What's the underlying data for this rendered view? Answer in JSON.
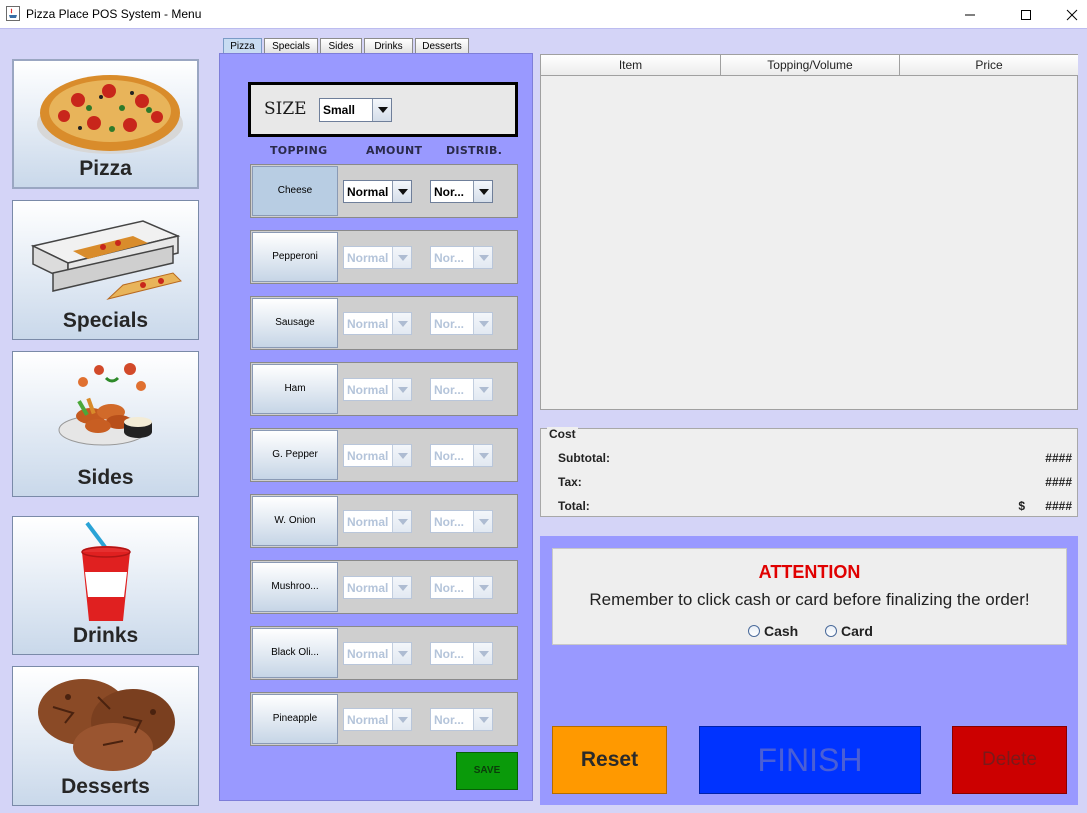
{
  "window": {
    "title": "Pizza Place POS System - Menu"
  },
  "nav": {
    "items": [
      {
        "label": "Pizza",
        "icon": "pizza-icon"
      },
      {
        "label": "Specials",
        "icon": "pizza-box-icon"
      },
      {
        "label": "Sides",
        "icon": "wings-icon"
      },
      {
        "label": "Drinks",
        "icon": "soda-cup-icon"
      },
      {
        "label": "Desserts",
        "icon": "cookies-icon"
      }
    ]
  },
  "tabs": [
    {
      "label": "Pizza",
      "selected": true
    },
    {
      "label": "Specials",
      "selected": false
    },
    {
      "label": "Sides",
      "selected": false
    },
    {
      "label": "Drinks",
      "selected": false
    },
    {
      "label": "Desserts",
      "selected": false
    }
  ],
  "pizza": {
    "size_label": "SIZE",
    "size_value": "Small",
    "headers": {
      "topping": "TOPPING",
      "amount": "AMOUNT",
      "distrib": "DISTRIB."
    },
    "toppings": [
      {
        "name": "Cheese",
        "amount": "Normal",
        "distrib": "Nor...",
        "enabled": true
      },
      {
        "name": "Pepperoni",
        "amount": "Normal",
        "distrib": "Nor...",
        "enabled": false
      },
      {
        "name": "Sausage",
        "amount": "Normal",
        "distrib": "Nor...",
        "enabled": false
      },
      {
        "name": "Ham",
        "amount": "Normal",
        "distrib": "Nor...",
        "enabled": false
      },
      {
        "name": "G. Pepper",
        "amount": "Normal",
        "distrib": "Nor...",
        "enabled": false
      },
      {
        "name": "W. Onion",
        "amount": "Normal",
        "distrib": "Nor...",
        "enabled": false
      },
      {
        "name": "Mushroo...",
        "amount": "Normal",
        "distrib": "Nor...",
        "enabled": false
      },
      {
        "name": "Black Oli...",
        "amount": "Normal",
        "distrib": "Nor...",
        "enabled": false
      },
      {
        "name": "Pineapple",
        "amount": "Normal",
        "distrib": "Nor...",
        "enabled": false
      }
    ],
    "save_label": "SAVE"
  },
  "order_table": {
    "columns": [
      "Item",
      "Topping/Volume",
      "Price"
    ]
  },
  "cost": {
    "title": "Cost",
    "subtotal_label": "Subtotal:",
    "subtotal_value": "####",
    "tax_label": "Tax:",
    "tax_value": "####",
    "total_label": "Total:",
    "total_currency": "$",
    "total_value": "####"
  },
  "attention": {
    "title": "ATTENTION",
    "message": "Remember to click cash or card before finalizing the order!",
    "cash_label": "Cash",
    "card_label": "Card"
  },
  "actions": {
    "reset_label": "Reset",
    "finish_label": "FINISH",
    "delete_label": "Delete"
  },
  "colors": {
    "panel": "#9999ff",
    "reset": "#ff9900",
    "finish": "#0033ff",
    "delete": "#cc0000",
    "save": "#0a9a0a",
    "attention": "#e00000"
  }
}
